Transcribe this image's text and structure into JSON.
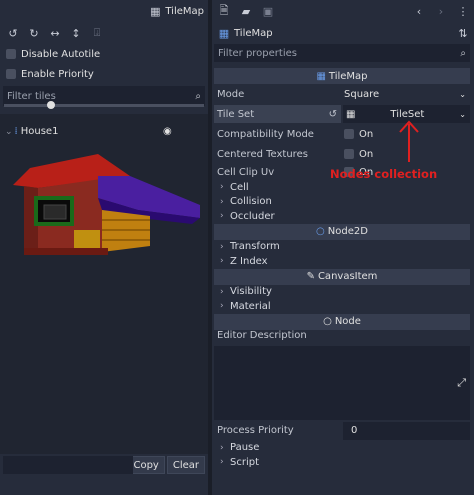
{
  "left": {
    "title": "TileMap",
    "options": [
      "Disable Autotile",
      "Enable Priority"
    ],
    "filter_placeholder": "Filter tiles",
    "tile_name": "House1",
    "copy_label": "Copy",
    "clear_label": "Clear"
  },
  "inspector": {
    "node_title": "TileMap",
    "filter_placeholder": "Filter properties",
    "section_tilemap": "TileMap",
    "mode_label": "Mode",
    "mode_value": "Square",
    "tileset_label": "Tile Set",
    "tileset_value": "TileSet",
    "compat_label": "Compatibility Mode",
    "compat_value": "On",
    "centered_label": "Centered Textures",
    "centered_value": "On",
    "clip_label": "Cell Clip Uv",
    "clip_value": "On",
    "annotation": "Nodes collection",
    "groups1": [
      "Cell",
      "Collision",
      "Occluder"
    ],
    "section_node2d": "Node2D",
    "groups2": [
      "Transform",
      "Z Index"
    ],
    "section_canvas": "CanvasItem",
    "groups3": [
      "Visibility",
      "Material"
    ],
    "section_node": "Node",
    "editor_desc_label": "Editor Description",
    "priority_label": "Process Priority",
    "priority_value": "0",
    "groups4": [
      "Pause",
      "Script"
    ]
  },
  "colors": {
    "annotation": "#e02020",
    "accent": "#699ce8"
  }
}
